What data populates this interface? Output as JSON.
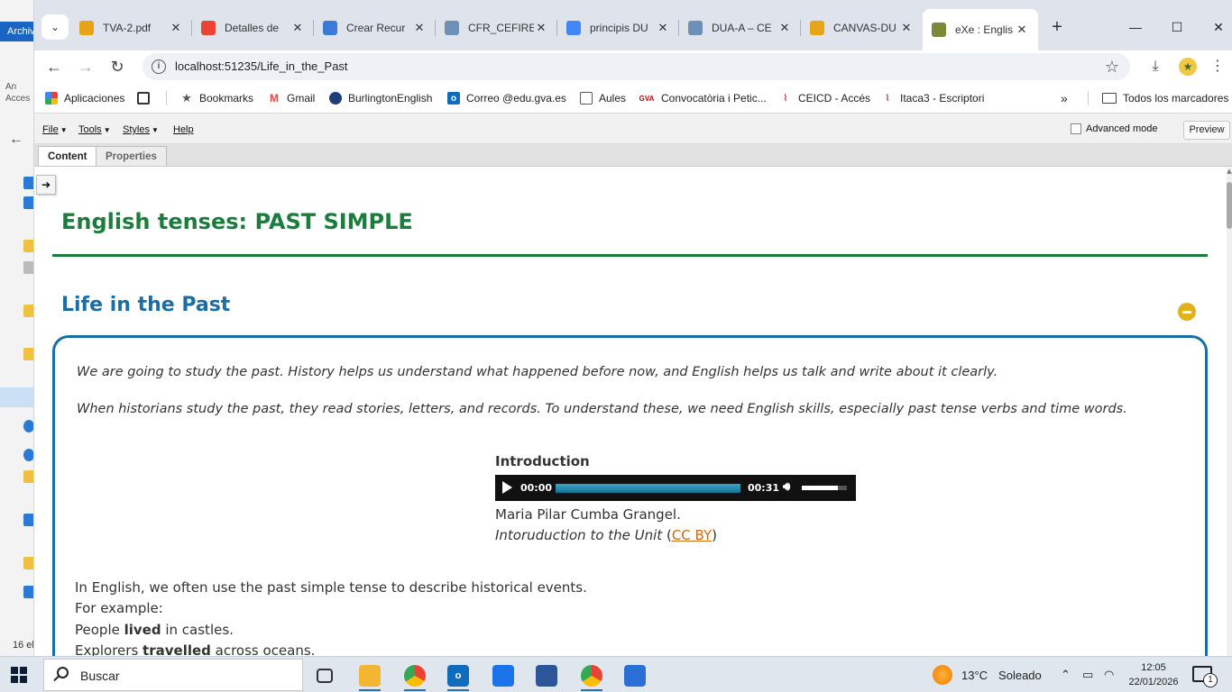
{
  "left_window": {
    "archive_label": "Archiv",
    "accesos_label": "An Acces",
    "item_count": "16 el"
  },
  "browser": {
    "tabs": [
      {
        "title": "TVA-2.pdf",
        "fav_color": "#e8a317"
      },
      {
        "title": "Detalles de",
        "fav_color": "#ea4335"
      },
      {
        "title": "Crear Recur",
        "fav_color": "#3a7bd5"
      },
      {
        "title": "CFR_CEFIRE",
        "fav_color": "#6d8fb8"
      },
      {
        "title": "principis DU",
        "fav_color": "#4285f4"
      },
      {
        "title": "DUA-A – CE",
        "fav_color": "#6d8fb8"
      },
      {
        "title": "CANVAS-DU",
        "fav_color": "#e8a317"
      },
      {
        "title": "eXe : Englis",
        "fav_color": "#7a8a3a"
      }
    ],
    "url": "localhost:51235/Life_in_the_Past",
    "bookmarks": {
      "apps": "Aplicaciones",
      "items": [
        "Bookmarks",
        "Gmail",
        "BurlingtonEnglish",
        "Correo @edu.gva.es",
        "Aules",
        "Convocatòria i Petic...",
        "CEICD - Accés",
        "Itaca3 - Escriptori"
      ],
      "all": "Todos los marcadores"
    }
  },
  "exe": {
    "menu": {
      "file": "File",
      "tools": "Tools",
      "styles": "Styles",
      "help": "Help"
    },
    "advanced_mode": "Advanced mode",
    "preview": "Preview",
    "tabs": {
      "content": "Content",
      "properties": "Properties"
    },
    "page_title": "English tenses: PAST SIMPLE",
    "idevice_title": "Life in the Past",
    "paragraphs": [
      "We are going to study the past. History helps us understand what happened before now, and English helps us talk and write about it clearly.",
      "When historians study the past, they read stories, letters, and records. To understand these, we need English skills, especially past tense verbs and time words."
    ],
    "media": {
      "heading": "Introduction",
      "current_time": "00:00",
      "duration": "00:31",
      "progress": 0.0,
      "volume": 0.8,
      "author": "Maria Pilar Cumba Grangel.",
      "work_title": "Intoruduction to the Unit",
      "license": "CC BY"
    },
    "body": {
      "intro": "In English, we often use the past simple tense to describe historical events.",
      "example": "For example:",
      "ex1_pre": "People ",
      "ex1_bold": "lived",
      "ex1_post": " in castles.",
      "ex2_pre": "Explorers ",
      "ex2_bold": "travelled",
      "ex2_post": " across oceans."
    }
  },
  "taskbar": {
    "search": "Buscar",
    "temperature": "13°C",
    "condition": "Soleado",
    "time": "12:05",
    "date": "22/01/2026",
    "notifications": "1"
  }
}
